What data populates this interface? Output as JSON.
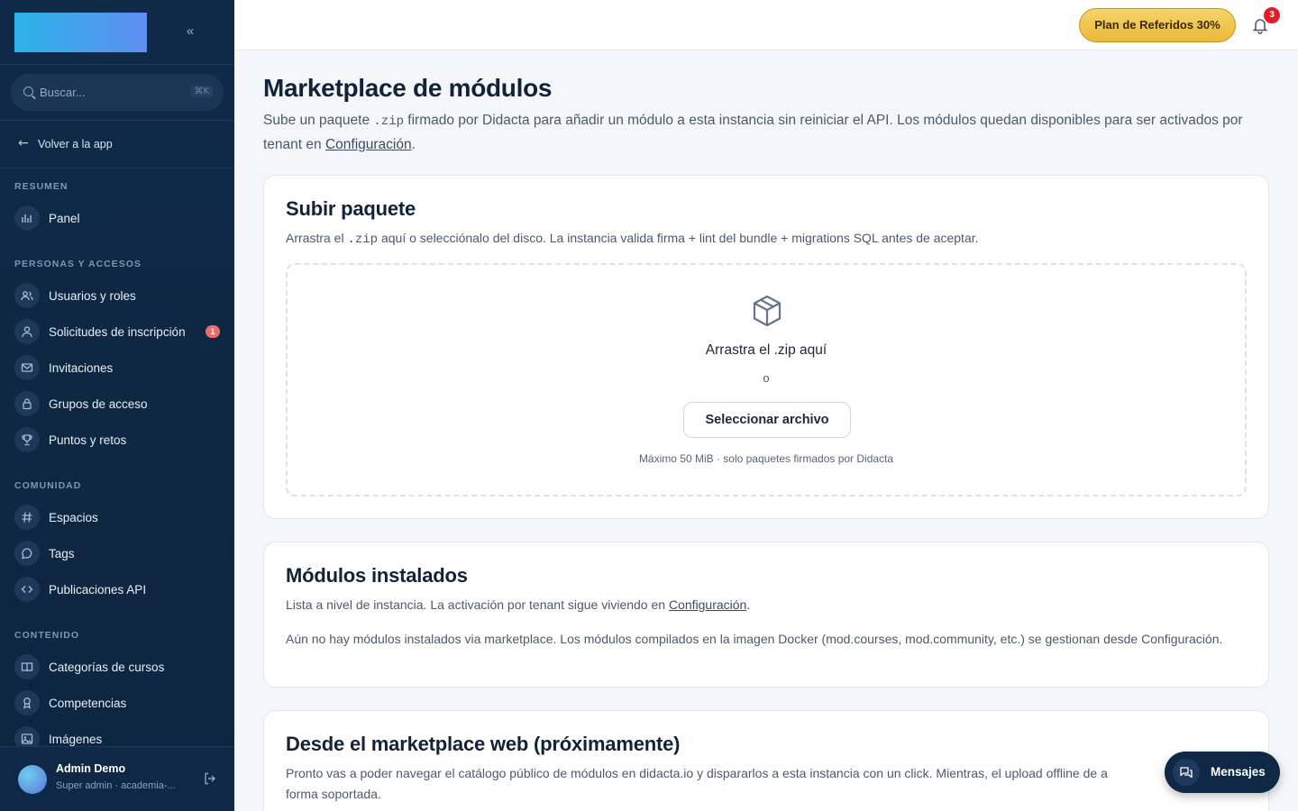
{
  "sidebar": {
    "collapse_glyph": "«",
    "search": {
      "placeholder": "Buscar...",
      "shortcut": "⌘K"
    },
    "back_label": "Volver a la app",
    "sections": [
      {
        "title": "RESUMEN",
        "items": [
          {
            "label": "Panel",
            "icon": "chart-icon"
          }
        ]
      },
      {
        "title": "PERSONAS Y ACCESOS",
        "items": [
          {
            "label": "Usuarios y roles",
            "icon": "users-icon"
          },
          {
            "label": "Solicitudes de inscripción",
            "icon": "user-icon",
            "badge": "1"
          },
          {
            "label": "Invitaciones",
            "icon": "mail-icon"
          },
          {
            "label": "Grupos de acceso",
            "icon": "lock-icon"
          },
          {
            "label": "Puntos y retos",
            "icon": "trophy-icon"
          }
        ]
      },
      {
        "title": "COMUNIDAD",
        "items": [
          {
            "label": "Espacios",
            "icon": "hash-icon"
          },
          {
            "label": "Tags",
            "icon": "chat-icon"
          },
          {
            "label": "Publicaciones API",
            "icon": "code-icon"
          }
        ]
      },
      {
        "title": "CONTENIDO",
        "items": [
          {
            "label": "Categorías de cursos",
            "icon": "book-icon"
          },
          {
            "label": "Competencias",
            "icon": "award-icon"
          },
          {
            "label": "Imágenes",
            "icon": "image-icon"
          }
        ]
      }
    ],
    "user": {
      "name": "Admin Demo",
      "role": "Super admin · academia-..."
    }
  },
  "topbar": {
    "referral_label": "Plan de Referidos 30%",
    "notifications_count": "3"
  },
  "page": {
    "title": "Marketplace de módulos",
    "subtitle_1": "Sube un paquete ",
    "subtitle_code": ".zip",
    "subtitle_2": " firmado por Didacta para añadir un módulo a esta instancia sin reiniciar el API. Los módulos quedan disponibles para ser activados por tenant en ",
    "subtitle_link": "Configuración",
    "subtitle_end": "."
  },
  "upload": {
    "title": "Subir paquete",
    "desc_1": "Arrastra el ",
    "desc_code": ".zip",
    "desc_2": " aquí o selecciónalo del disco. La instancia valida firma + lint del bundle + migrations SQL antes de aceptar.",
    "drop_title": "Arrastra el .zip aquí",
    "or": "o",
    "select_button": "Seleccionar archivo",
    "hint": "Máximo 50 MiB · solo paquetes firmados por Didacta"
  },
  "installed": {
    "title": "Módulos instalados",
    "desc_1": "Lista a nivel de instancia. La activación por tenant sigue viviendo en ",
    "desc_link": "Configuración",
    "desc_end": ".",
    "empty": "Aún no hay módulos instalados via marketplace. Los módulos compilados en la imagen Docker (mod.courses, mod.community, etc.) se gestionan desde Configuración."
  },
  "web_marketplace": {
    "title": "Desde el marketplace web (próximamente)",
    "desc": "Pronto vas a poder navegar el catálogo público de módulos en didacta.io y dispararlos a esta instancia con un click. Mientras, el upload offline de a",
    "desc_line2": "forma soportada."
  },
  "messages_button": "Mensajes"
}
